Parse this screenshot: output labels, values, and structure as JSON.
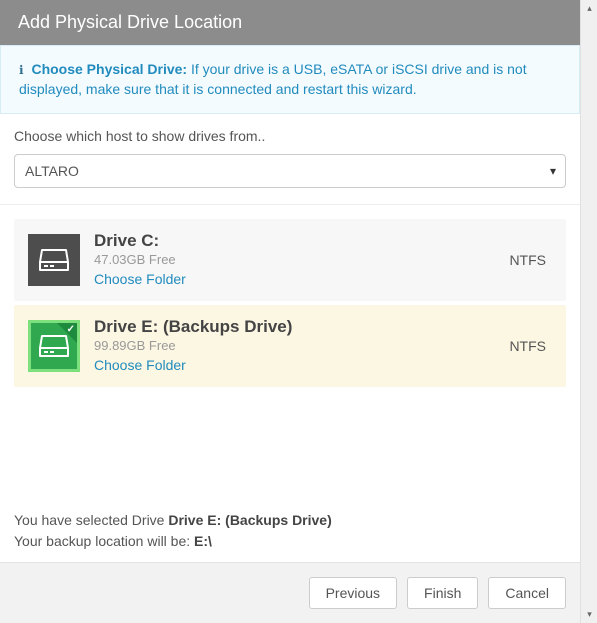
{
  "title": "Add Physical Drive Location",
  "banner": {
    "strong": "Choose Physical Drive:",
    "text": " If your drive is a USB, eSATA or iSCSI drive and is not displayed, make sure that it is connected and restart this wizard."
  },
  "host": {
    "label": "Choose which host to show drives from..",
    "value": "ALTARO"
  },
  "drives": [
    {
      "name": "Drive C:",
      "free": "47.03GB Free",
      "choose": "Choose Folder",
      "fs": "NTFS",
      "selected": false
    },
    {
      "name": "Drive E: (Backups Drive)",
      "free": "99.89GB Free",
      "choose": "Choose Folder",
      "fs": "NTFS",
      "selected": true
    }
  ],
  "summary": {
    "line1_prefix": "You have selected Drive ",
    "line1_bold": "Drive E: (Backups Drive)",
    "line2_prefix": "Your backup location will be: ",
    "line2_bold": "E:\\"
  },
  "buttons": {
    "previous": "Previous",
    "finish": "Finish",
    "cancel": "Cancel"
  }
}
